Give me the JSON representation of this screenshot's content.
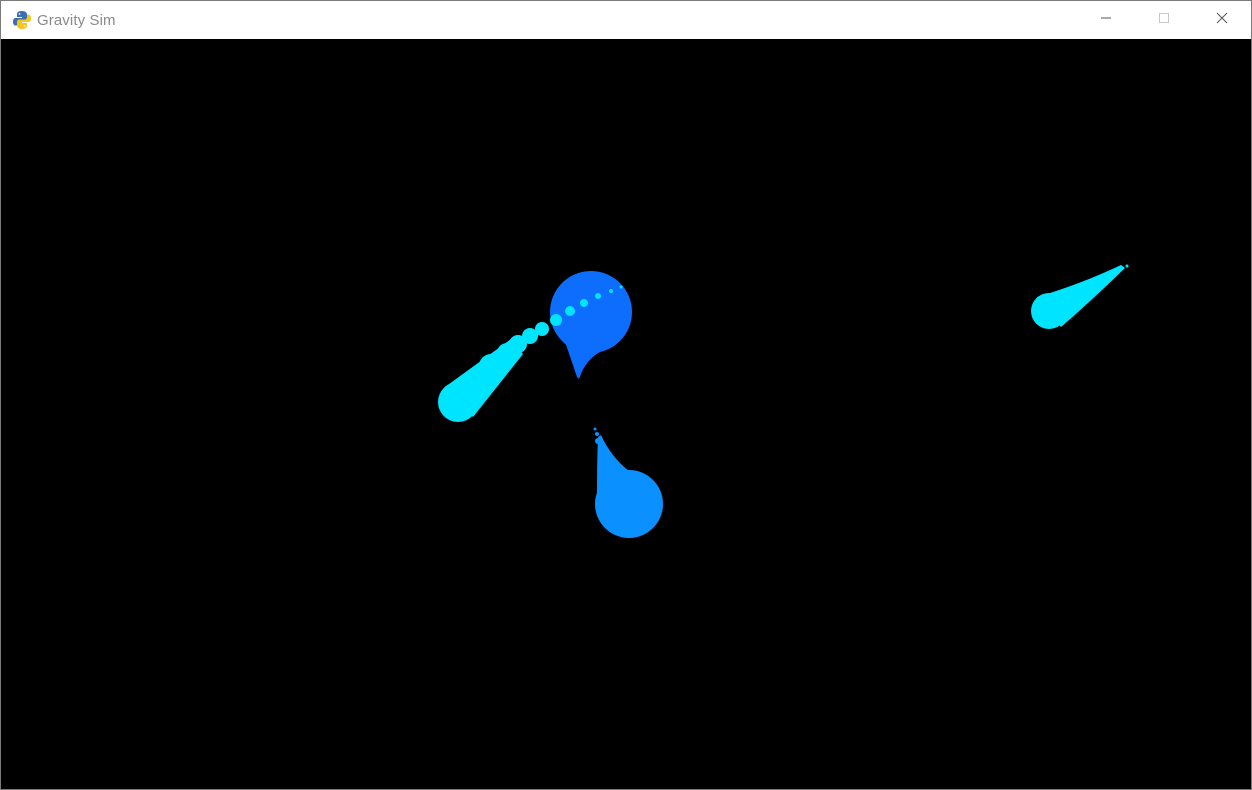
{
  "window": {
    "title": "Gravity Sim",
    "app_icon": "python-snake-icon",
    "controls": {
      "minimize_icon": "minimize-icon",
      "maximize_icon": "maximize-icon",
      "close_icon": "close-icon"
    }
  },
  "scene": {
    "background_color": "#000000",
    "bodies": [
      {
        "name": "large-blue-body",
        "color": "#0d6efd"
      },
      {
        "name": "cyan-body-left",
        "color": "#00e5ff"
      },
      {
        "name": "azure-body-bottom",
        "color": "#0a90ff"
      },
      {
        "name": "cyan-body-right",
        "color": "#00e5ff"
      }
    ]
  }
}
